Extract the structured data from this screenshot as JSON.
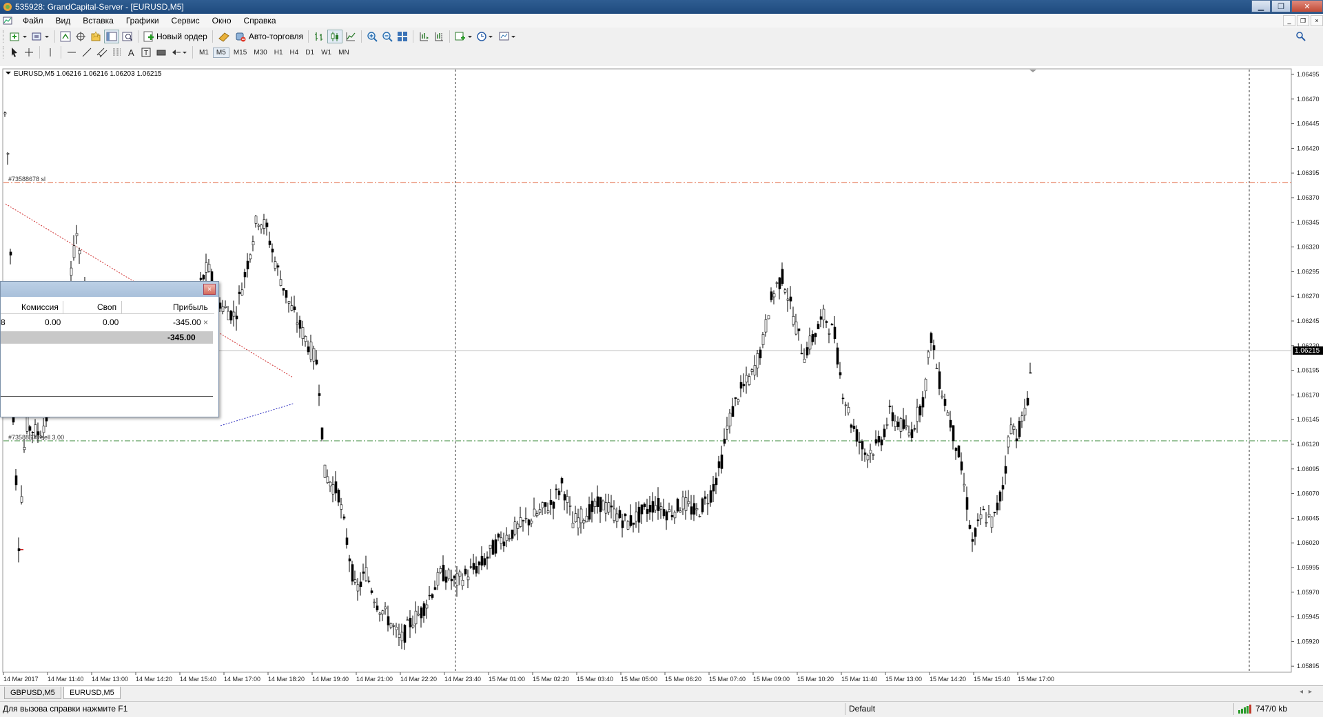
{
  "window": {
    "title": "535928: GrandCapital-Server - [EURUSD,M5]",
    "minimize": "▁",
    "restore": "❐",
    "close": "✕"
  },
  "menu": [
    "Файл",
    "Вид",
    "Вставка",
    "Графики",
    "Сервис",
    "Окно",
    "Справка"
  ],
  "toolbar": {
    "new_order": "Новый ордер",
    "auto_trading": "Авто-торговля",
    "timeframes": [
      "M1",
      "M5",
      "M15",
      "M30",
      "H1",
      "H4",
      "D1",
      "W1",
      "MN"
    ],
    "active_timeframe": "M5"
  },
  "chart": {
    "header": "EURUSD,M5  1.06216 1.06216 1.06203 1.06215",
    "sl_label": "#73588678 sl",
    "order_label": "#73588678 sell 3.00",
    "current_price": "1.06215",
    "price_ticks": [
      "1.06495",
      "1.06470",
      "1.06445",
      "1.06420",
      "1.06395",
      "1.06370",
      "1.06345",
      "1.06320",
      "1.06295",
      "1.06270",
      "1.06245",
      "1.06220",
      "1.06195",
      "1.06170",
      "1.06145",
      "1.06120",
      "1.06095",
      "1.06070",
      "1.06045",
      "1.06020",
      "1.05995",
      "1.05970",
      "1.05945",
      "1.05920",
      "1.05895"
    ],
    "time_ticks": [
      "14 Mar 2017",
      "14 Mar 11:40",
      "14 Mar 13:00",
      "14 Mar 14:20",
      "14 Mar 15:40",
      "14 Mar 17:00",
      "14 Mar 18:20",
      "14 Mar 19:40",
      "14 Mar 21:00",
      "14 Mar 22:20",
      "14 Mar 23:40",
      "15 Mar 01:00",
      "15 Mar 02:20",
      "15 Mar 03:40",
      "15 Mar 05:00",
      "15 Mar 06:20",
      "15 Mar 07:40",
      "15 Mar 09:00",
      "15 Mar 10:20",
      "15 Mar 11:40",
      "15 Mar 13:00",
      "15 Mar 14:20",
      "15 Mar 15:40",
      "15 Mar 17:00"
    ],
    "colors": {
      "sl_line": "#e0603a",
      "order_line": "#3a8a3a",
      "bid_line": "#c0c0c0",
      "candles": "#000000"
    }
  },
  "terminal": {
    "columns": [
      "Комиссия",
      "Своп",
      "Прибыль"
    ],
    "row": {
      "commission": "0.00",
      "swap": "0.00",
      "profit": "-345.00",
      "partial_left": "8"
    },
    "total": "-345.00"
  },
  "tabs": [
    "GBPUSD,M5",
    "EURUSD,M5"
  ],
  "active_tab": "EURUSD,M5",
  "status": {
    "help": "Для вызова справки нажмите F1",
    "profile": "Default",
    "traffic": "747/0 kb"
  }
}
